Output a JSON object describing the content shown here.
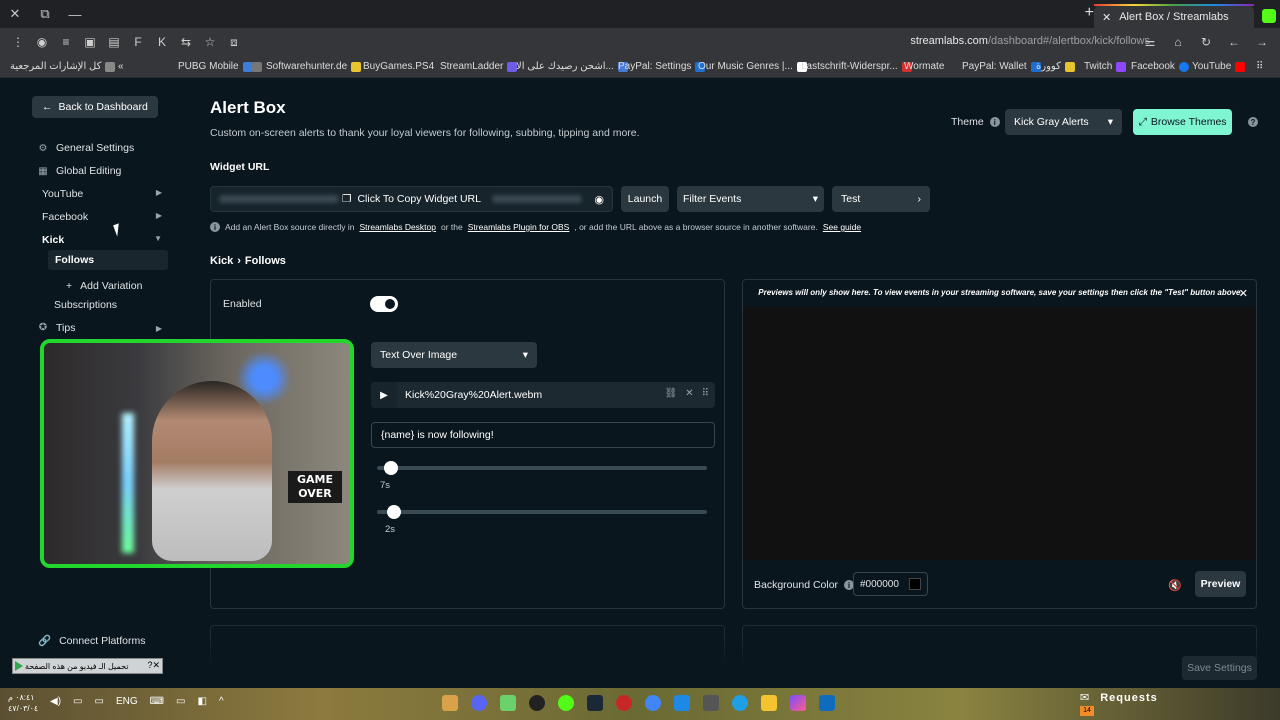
{
  "browser": {
    "tab_title": "Alert Box / Streamlabs",
    "url_host": "streamlabs.com",
    "url_path": "/dashboard#/alertbox/kick/follows",
    "bookmarks": [
      "كل الإشارات المرجعية",
      "PUBG Mobile",
      "Softwarehunter.de",
      "BuyGames.PS4",
      "StreamLadder",
      "اشحن رصيدك على الا...",
      "PayPal: Settings",
      "Our Music Genres |...",
      "Lastschrift-Widerspr...",
      "Wormate",
      "PayPal: Wallet",
      "كوورة",
      "Twitch",
      "Facebook",
      "YouTube"
    ]
  },
  "sidebar": {
    "back_label": "Back to Dashboard",
    "general_settings": "General Settings",
    "global_editing": "Global Editing",
    "youtube": "YouTube",
    "facebook": "Facebook",
    "kick": "Kick",
    "follows": "Follows",
    "add_variation": "Add Variation",
    "subscriptions": "Subscriptions",
    "tips": "Tips",
    "connect_platforms": "Connect Platforms"
  },
  "header": {
    "title": "Alert Box",
    "subtitle": "Custom on-screen alerts to thank your loyal viewers for following, subbing, tipping and more.",
    "theme_label": "Theme",
    "theme_value": "Kick Gray Alerts",
    "browse_label": "Browse Themes"
  },
  "widget": {
    "label": "Widget URL",
    "copy_label": "Click To Copy Widget URL",
    "launch_label": "Launch",
    "filter_label": "Filter Events",
    "test_label": "Test",
    "help_prefix": "Add an Alert Box source directly in",
    "help_link1": "Streamlabs Desktop",
    "help_mid": "or the",
    "help_link2": "Streamlabs Plugin for OBS",
    "help_suffix": ", or add the URL above as a browser source in another software.",
    "help_link3": "See guide"
  },
  "crumbs": {
    "platform": "Kick",
    "separator": "›",
    "event": "Follows"
  },
  "settings": {
    "enabled_label": "Enabled",
    "enabled": true,
    "layout_value": "Text Over Image",
    "file_name": "Kick%20Gray%20Alert.webm",
    "message": "{name} is now following!",
    "duration_value": "7s",
    "duration_fraction": 0.02,
    "delay_value": "2s",
    "delay_fraction": 0.03
  },
  "preview": {
    "note": "Previews will only show here. To view events in your streaming software, save your settings then click the \"Test\" button above.",
    "bg_label": "Background Color",
    "bg_value": "#000000",
    "preview_label": "Preview"
  },
  "footer": {
    "save_label": "Save Settings"
  },
  "webcam": {
    "sign_text": "GAME OVER"
  },
  "taskbar": {
    "download_text": "تحميل الـ فيديو من هذه الصفحة",
    "lang": "ENG",
    "time": "٠٨:٤١ م",
    "date": "٤٧/٠٣/٠٤",
    "requests_label": "Requests",
    "requests_count": "14"
  },
  "colors": {
    "accent": "#80f5d2",
    "kick_green": "#53fc18",
    "bg": "#09161d"
  }
}
